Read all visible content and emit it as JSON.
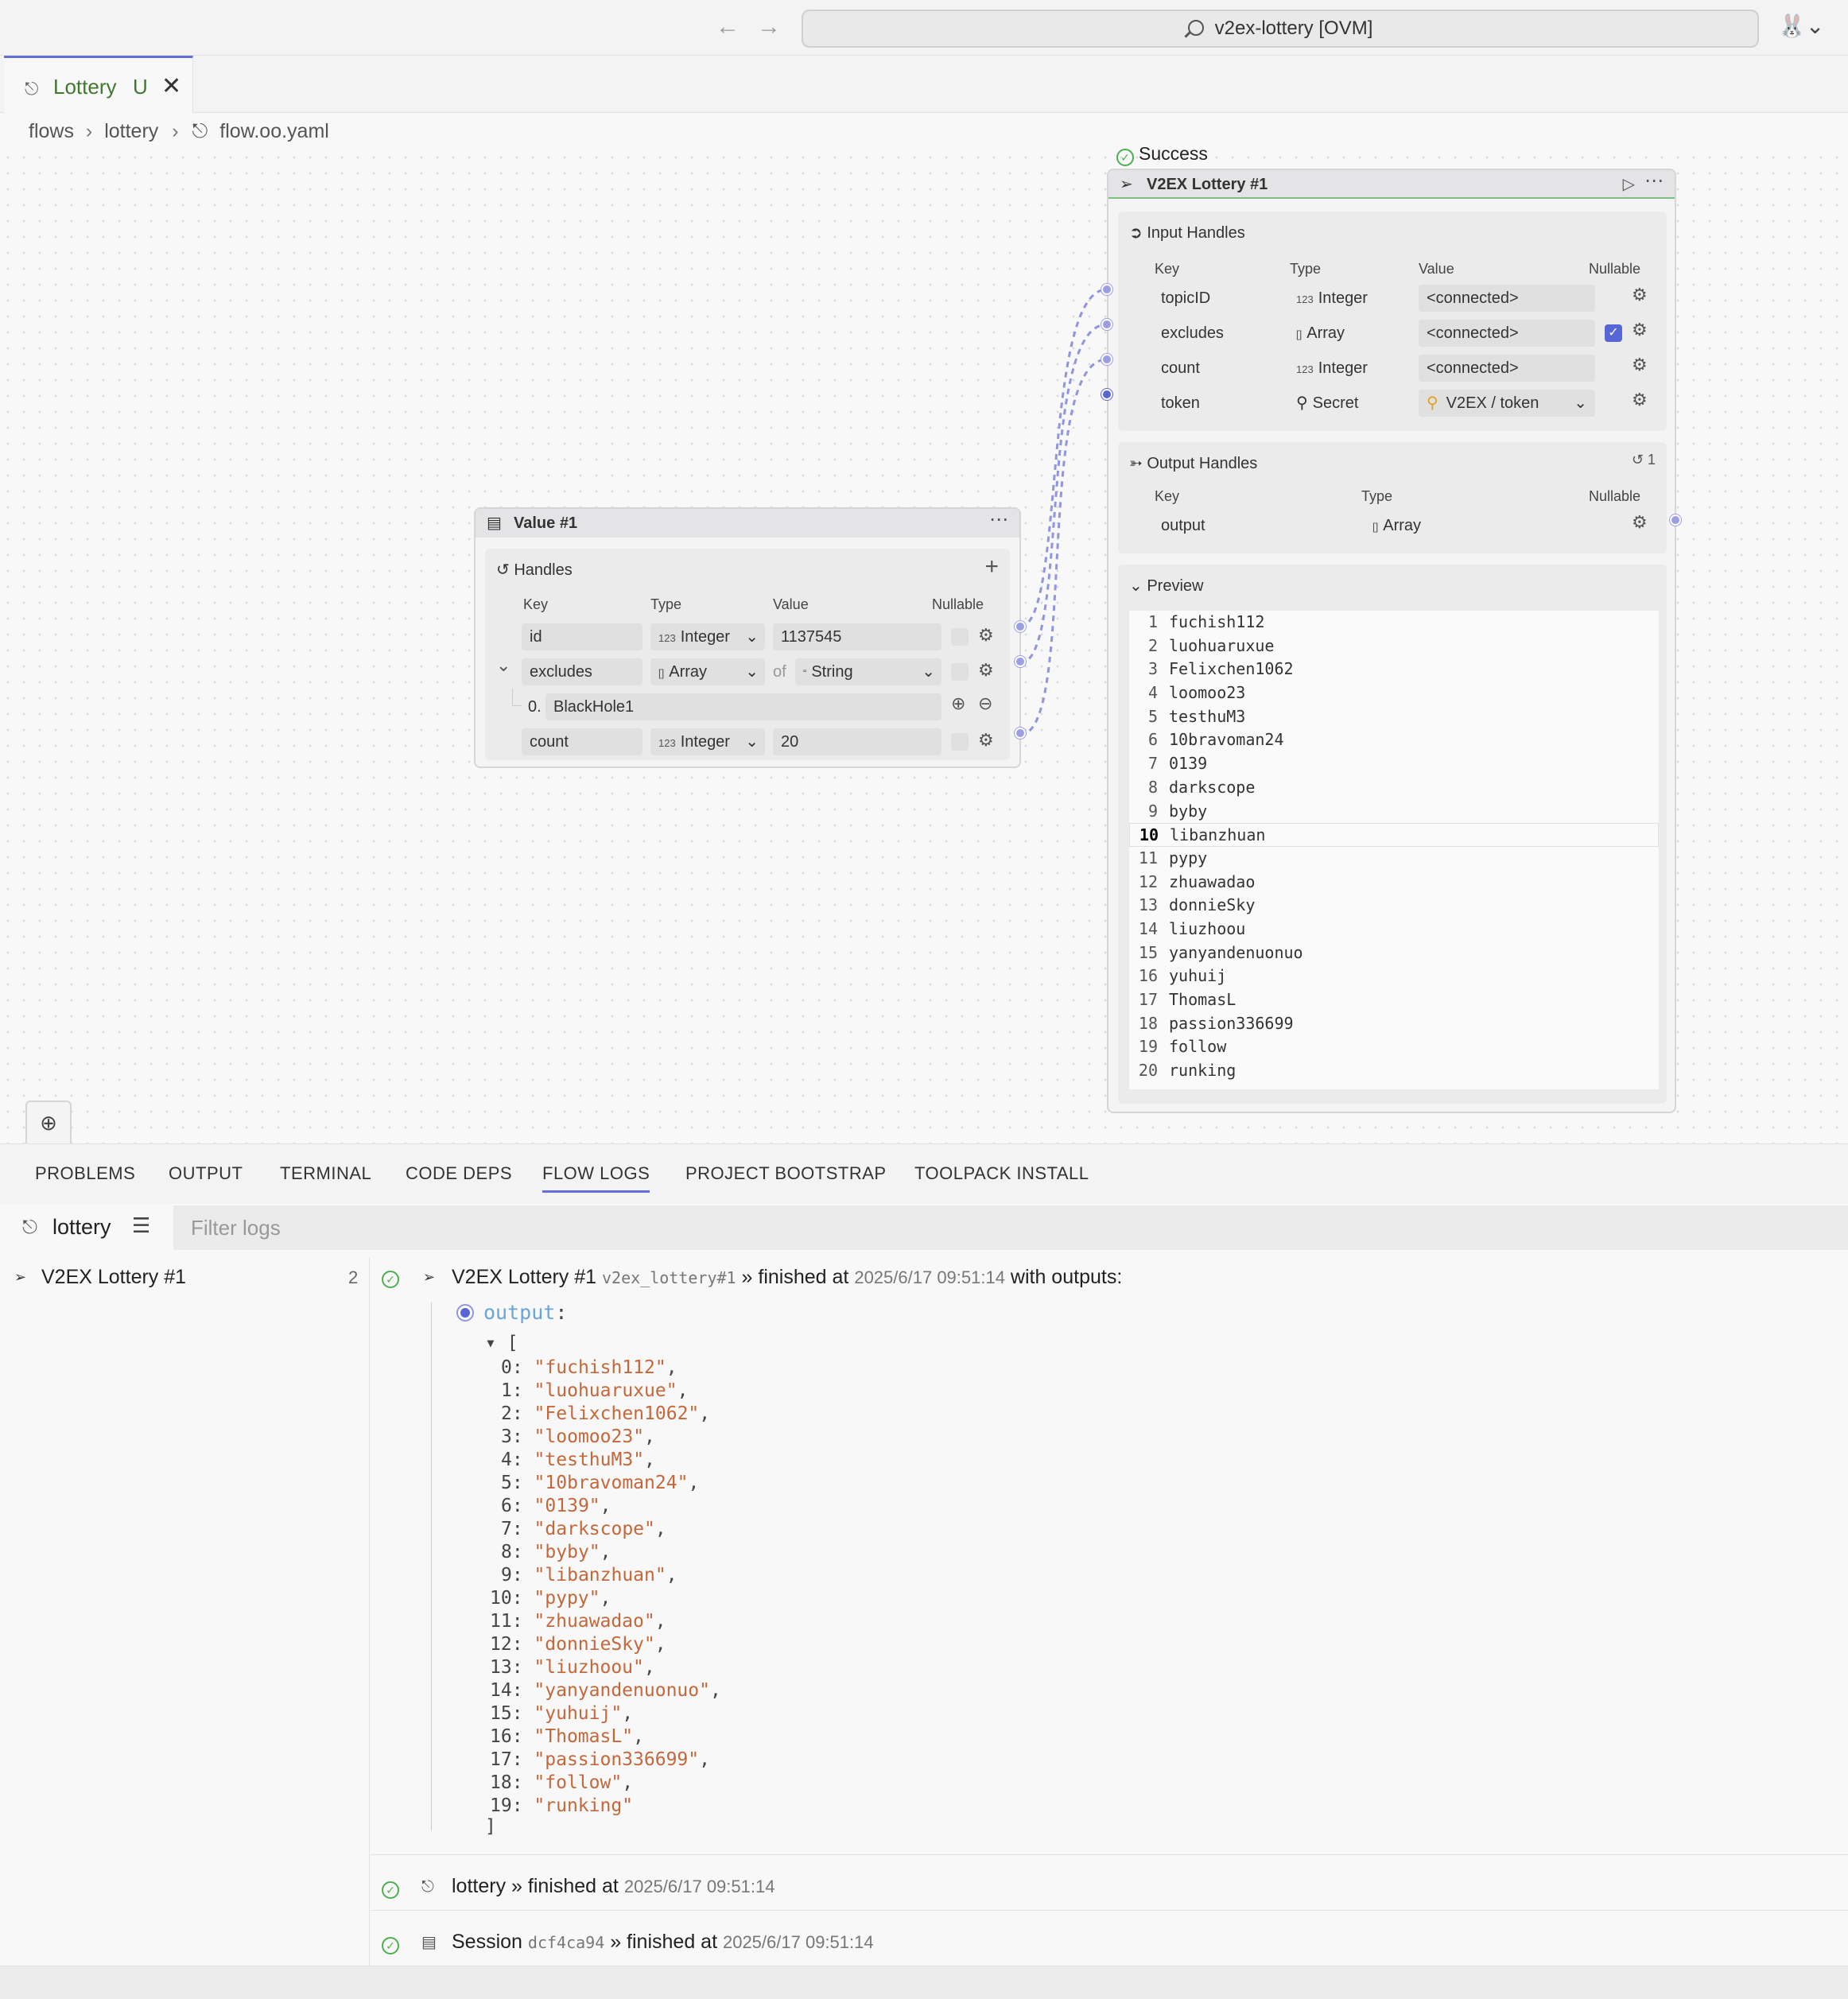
{
  "window": {
    "command_center": "v2ex-lottery [OVM]"
  },
  "tab": {
    "label": "Lottery",
    "status": "U"
  },
  "breadcrumb": [
    "flows",
    "lottery",
    "flow.oo.yaml"
  ],
  "value_node": {
    "title": "Value #1",
    "section": "Handles",
    "columns": {
      "key": "Key",
      "type": "Type",
      "value": "Value",
      "nullable": "Nullable"
    },
    "rows": [
      {
        "key": "id",
        "type": "Integer",
        "type_icon": "123",
        "value": "1137545"
      },
      {
        "key": "excludes",
        "type": "Array",
        "type_icon": "[]",
        "of": "of",
        "of_type": "String",
        "of_icon": "“"
      },
      {
        "key": "count",
        "type": "Integer",
        "type_icon": "123",
        "value": "20"
      }
    ],
    "array_item": {
      "index": "0.",
      "value": "BlackHole1"
    }
  },
  "task_node": {
    "status": "Success",
    "title": "V2EX Lottery #1",
    "input_section": "Input Handles",
    "input_columns": {
      "key": "Key",
      "type": "Type",
      "value": "Value",
      "nullable": "Nullable"
    },
    "inputs": [
      {
        "key": "topicID",
        "type": "Integer",
        "type_icon": "123",
        "value": "<connected>",
        "nullable": false
      },
      {
        "key": "excludes",
        "type": "Array",
        "type_icon": "[]",
        "value": "<connected>",
        "nullable": true
      },
      {
        "key": "count",
        "type": "Integer",
        "type_icon": "123",
        "value": "<connected>",
        "nullable": false
      },
      {
        "key": "token",
        "type": "Secret",
        "type_icon": "key",
        "value": "V2EX / token",
        "nullable": false
      }
    ],
    "output_section": "Output Handles",
    "output_history_count": "1",
    "output_columns": {
      "key": "Key",
      "type": "Type",
      "nullable": "Nullable"
    },
    "outputs": [
      {
        "key": "output",
        "type": "Array",
        "type_icon": "[]"
      }
    ],
    "preview_label": "Preview",
    "preview": [
      "fuchish112",
      "luohuaruxue",
      "Felixchen1062",
      "loomoo23",
      "testhuM3",
      "10bravoman24",
      "0139",
      "darkscope",
      "byby",
      "libanzhuan",
      "pypy",
      "zhuawadao",
      "donnieSky",
      "liuzhoou",
      "yanyandenuonuo",
      "yuhuij",
      "ThomasL",
      "passion336699",
      "follow",
      "runking"
    ],
    "preview_selected_line": 10
  },
  "panel_tabs": [
    "PROBLEMS",
    "OUTPUT",
    "TERMINAL",
    "CODE DEPS",
    "FLOW LOGS",
    "PROJECT BOOTSTRAP",
    "TOOLPACK INSTALL"
  ],
  "panel_active_tab": "FLOW LOGS",
  "logs": {
    "flow_name": "lottery",
    "filter_placeholder": "Filter logs",
    "tree": [
      {
        "label": "V2EX Lottery #1",
        "count": "2"
      }
    ],
    "entries": [
      {
        "name": "V2EX Lottery #1",
        "id": "v2ex_lottery#1",
        "sep": "»",
        "text": "finished at",
        "time": "2025/6/17 09:51:14",
        "suffix": "with outputs:"
      },
      {
        "name": "lottery",
        "sep": "»",
        "text": "finished at",
        "time": "2025/6/17 09:51:14"
      },
      {
        "name": "Session",
        "id": "dcf4ca94",
        "sep": "»",
        "text": "finished at",
        "time": "2025/6/17 09:51:14"
      }
    ],
    "output_key": "output",
    "output_values": [
      "fuchish112",
      "luohuaruxue",
      "Felixchen1062",
      "loomoo23",
      "testhuM3",
      "10bravoman24",
      "0139",
      "darkscope",
      "byby",
      "libanzhuan",
      "pypy",
      "zhuawadao",
      "donnieSky",
      "liuzhoou",
      "yanyandenuonuo",
      "yuhuij",
      "ThomasL",
      "passion336699",
      "follow",
      "runking"
    ]
  }
}
